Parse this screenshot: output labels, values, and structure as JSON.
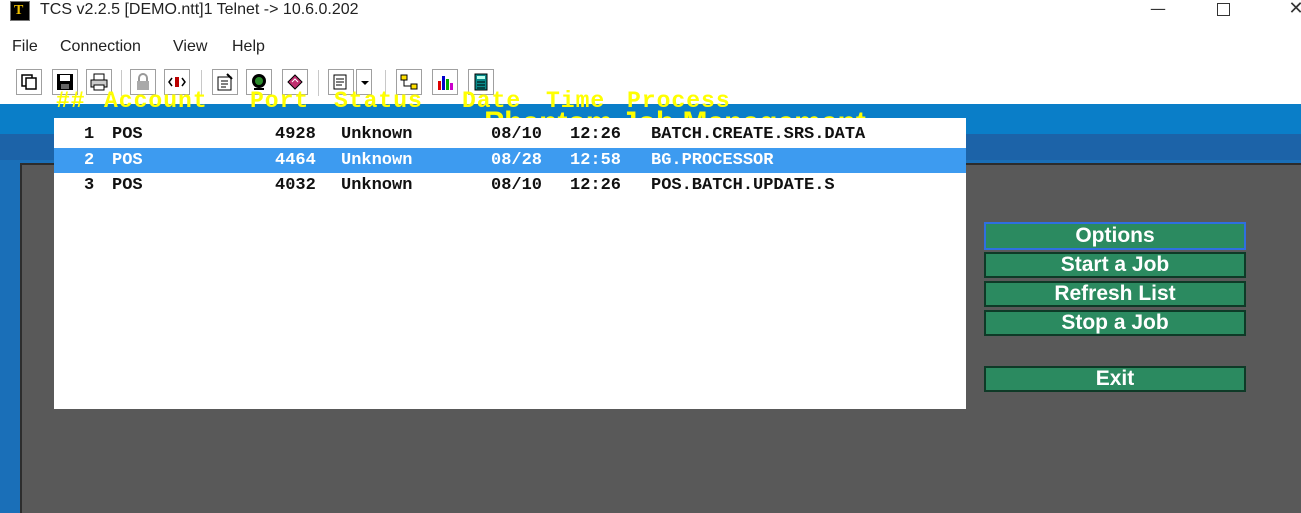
{
  "window": {
    "title": "TCS v2.2.5 [DEMO.ntt]1 Telnet -> 10.6.0.202",
    "icon": "app-icon",
    "controls": {
      "minimize": "—",
      "close": "✕"
    }
  },
  "menu": [
    "File",
    "Connection",
    "View",
    "Help"
  ],
  "toolbar": {
    "buttons": [
      "copy-icon",
      "save-icon",
      "print-icon",
      "lock-icon",
      "sound-icon",
      "properties-icon",
      "terminal-icon",
      "script-icon",
      "paste-dropdown-icon",
      "network-icon",
      "chart-icon",
      "calculator-icon"
    ]
  },
  "screen": {
    "title": "Phantom Job Management",
    "headers": {
      "num": "##",
      "account": "Account",
      "port": "Port",
      "status": "Status",
      "date": "Date",
      "time": "Time",
      "process": "Process"
    },
    "rows": [
      {
        "num": "1",
        "account": "POS",
        "port": "4928",
        "status": "Unknown",
        "date": "08/10",
        "time": "12:26",
        "process": "BATCH.CREATE.SRS.DATA",
        "selected": false
      },
      {
        "num": "2",
        "account": "POS",
        "port": "4464",
        "status": "Unknown",
        "date": "08/28",
        "time": "12:58",
        "process": "BG.PROCESSOR",
        "selected": true
      },
      {
        "num": "3",
        "account": "POS",
        "port": "4032",
        "status": "Unknown",
        "date": "08/10",
        "time": "12:26",
        "process": "POS.BATCH.UPDATE.S",
        "selected": false
      }
    ],
    "buttons": {
      "options": "Options",
      "start": "Start a Job",
      "refresh": "Refresh List",
      "stop": "Stop a Job",
      "exit": "Exit"
    }
  },
  "colors": {
    "terminal_blue": "#1a6fb8",
    "header_yellow": "#ffff00",
    "panel_gray": "#595959",
    "button_green": "#2b8a60",
    "selection_blue": "#3d9bf0"
  }
}
